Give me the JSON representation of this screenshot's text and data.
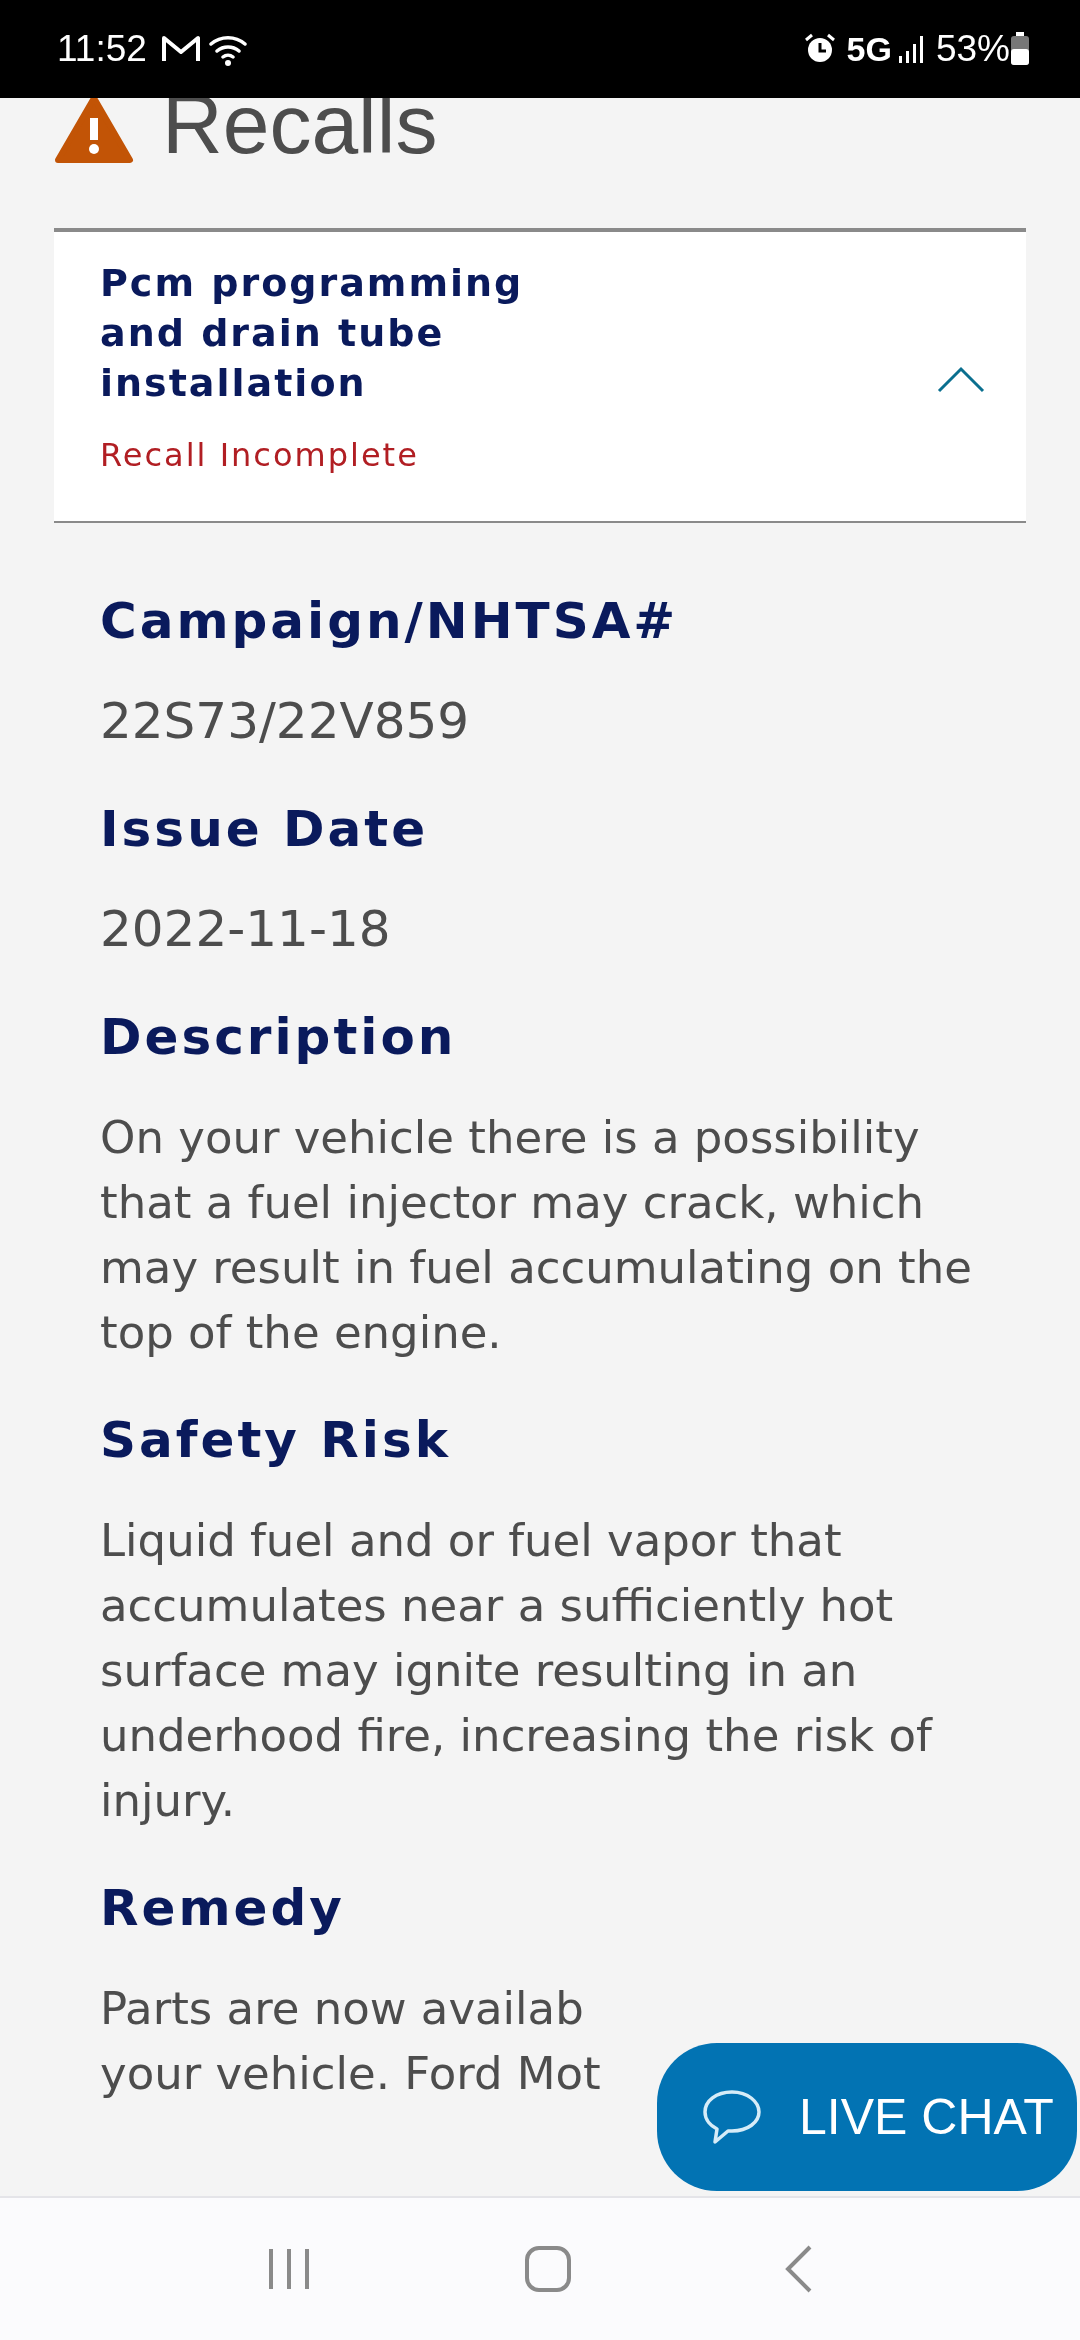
{
  "status_bar": {
    "time": "11:52",
    "network": "5G",
    "battery": "53%"
  },
  "page_title": "Recalls",
  "recall": {
    "title": "Pcm programming and drain tube installation",
    "status": "Recall Incomplete",
    "expanded": true
  },
  "details": [
    {
      "kind": "field",
      "label": "Campaign/NHTSA#",
      "value": "22S73/22V859"
    },
    {
      "kind": "field",
      "label": "Issue Date",
      "value": "2022-11-18"
    },
    {
      "kind": "paragraph",
      "label": "Description",
      "value": "On your vehicle there is a possibility that a fuel injector may crack, which may result in fuel accumulating on the top of the engine."
    },
    {
      "kind": "paragraph",
      "label": "Safety Risk",
      "value": "Liquid fuel and or fuel vapor that accumulates near a sufficiently hot surface may ignite resulting in an underhood fire, increasing the risk of injury."
    },
    {
      "kind": "cut",
      "label": "Remedy",
      "lines": [
        "Parts are now availab",
        "your vehicle. Ford Mot"
      ]
    }
  ],
  "live_chat": {
    "label": "LIVE CHAT"
  }
}
